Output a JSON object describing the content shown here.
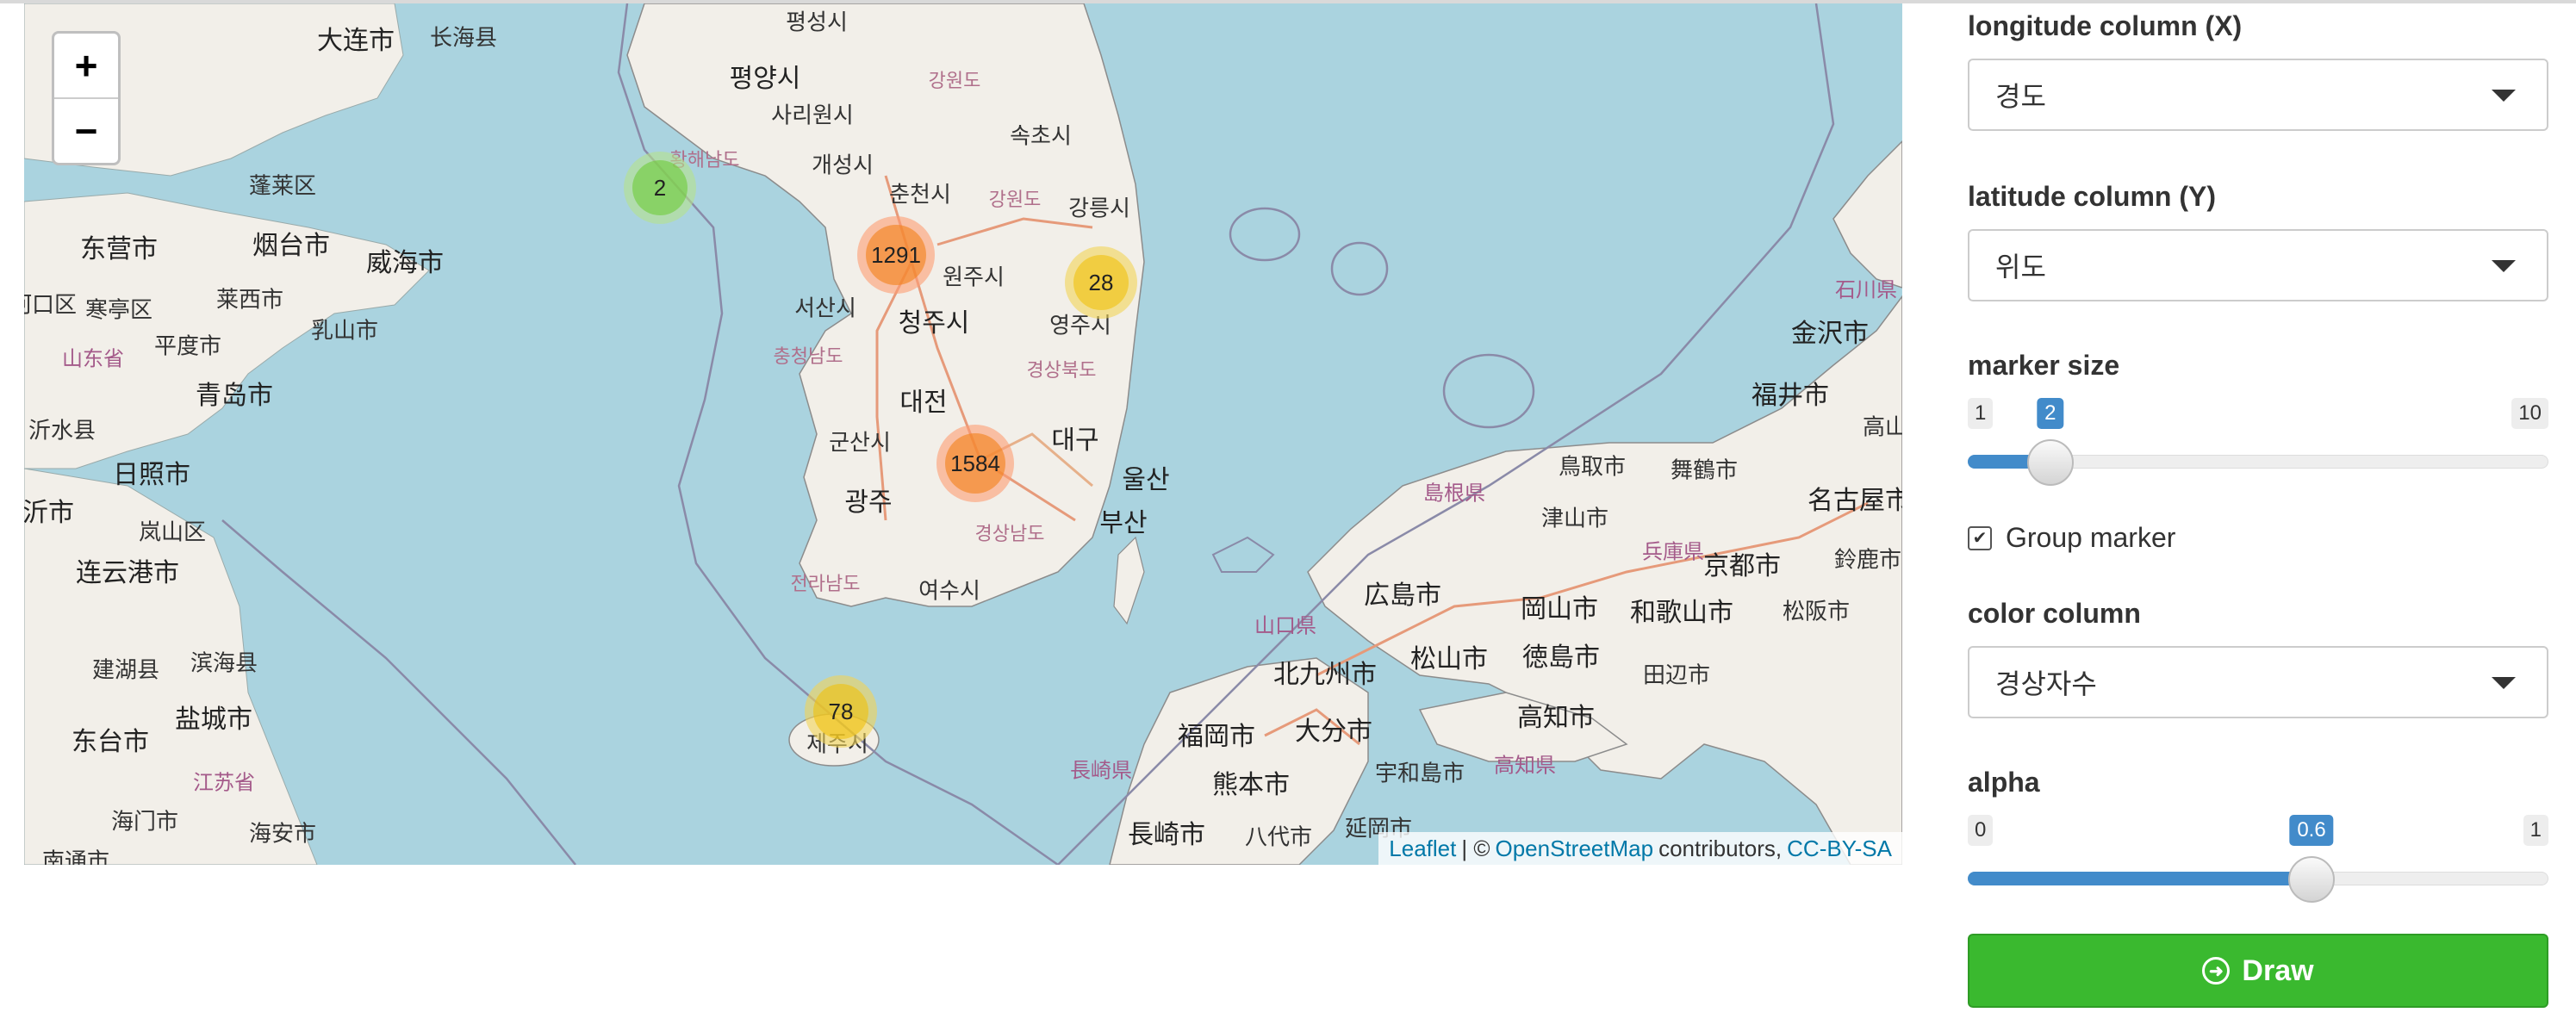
{
  "map": {
    "zoom_in": "+",
    "zoom_out": "−",
    "places": {
      "dalian": "大连市",
      "changhai": "长海县",
      "pyongsong": "평성시",
      "pyongyang": "평양시",
      "gangwon_n": "강원도",
      "sariwon": "사리원시",
      "hwanghae_s": "황해남도",
      "gaeseong": "개성시",
      "sokcho": "속초시",
      "chuncheon": "춘천시",
      "gangwon_s": "강원도",
      "gangneung": "강릉시",
      "wonju": "원주시",
      "seosan": "서산시",
      "cheongju": "청주시",
      "yeongju": "영주시",
      "chungnam": "충청남도",
      "gyeongbuk": "경상북도",
      "daejeon": "대전",
      "gunsan": "군산시",
      "daegu": "대구",
      "gwangju": "광주",
      "ulsan": "울산",
      "busan": "부산",
      "gyeongnam": "경상남도",
      "jeonnam": "전라남도",
      "yeosu": "여수시",
      "jeju": "제주시",
      "penglai": "蓬莱区",
      "dongying": "东营市",
      "yantai": "烟台市",
      "weihai": "威海市",
      "laixi": "莱西市",
      "pingdu": "平度市",
      "rushan": "乳山市",
      "shandong": "山东省",
      "hekou": "河口区",
      "hanting": "寒亭区",
      "qingdao": "青岛市",
      "yishui": "沂水县",
      "rizhao": "日照市",
      "linyi": "沂市",
      "lanshan": "岚山区",
      "lianyungang": "连云港市",
      "jianhu": "建湖县",
      "binhai": "滨海县",
      "yancheng": "盐城市",
      "dongtai": "东台市",
      "jiangsu": "江苏省",
      "haimen": "海门市",
      "haian": "海安市",
      "nantong": "南通市",
      "kanazawa": "金沢市",
      "ishikawa": "石川県",
      "fukui": "福井市",
      "tottori": "鳥取市",
      "maizuru": "舞鶴市",
      "shimane": "島根県",
      "tsuyama": "津山市",
      "hyogo": "兵庫県",
      "nagoya": "名古屋市",
      "kyoto": "京都市",
      "suzuka": "鈴鹿市",
      "hiroshima": "広島市",
      "okayama": "岡山市",
      "wakayama": "和歌山市",
      "matsusaka": "松阪市",
      "yamaguchi": "山口県",
      "kitakyushu": "北九州市",
      "matsuyama": "松山市",
      "tokushima": "徳島市",
      "tanabe": "田辺市",
      "fukuoka": "福岡市",
      "oita": "大分市",
      "kochi": "高知市",
      "nagasaki_p": "長崎県",
      "kumamoto": "熊本市",
      "uwajima": "宇和島市",
      "kochi_p": "高知県",
      "nagasaki": "長崎市",
      "yatsushiro": "八代市",
      "miyazaki": "延岡市",
      "takayama": "高山"
    },
    "clusters": [
      {
        "count": "2",
        "size": "small"
      },
      {
        "count": "1291",
        "size": "large"
      },
      {
        "count": "28",
        "size": "medium"
      },
      {
        "count": "1584",
        "size": "large"
      },
      {
        "count": "78",
        "size": "medium"
      }
    ],
    "attribution": {
      "leaflet": "Leaflet",
      "sep": "| ©",
      "osm": "OpenStreetMap",
      "contributors": "contributors,",
      "license": "CC-BY-SA"
    }
  },
  "controls": {
    "longitude": {
      "label": "longitude column (X)",
      "value": "경도"
    },
    "latitude": {
      "label": "latitude column (Y)",
      "value": "위도"
    },
    "marker_size": {
      "label": "marker size",
      "min": "1",
      "max": "10",
      "value": "2",
      "fraction": 0.111
    },
    "group_marker": {
      "label": "Group marker",
      "checked": true,
      "check_glyph": "✔"
    },
    "color_column": {
      "label": "color column",
      "value": "경상자수"
    },
    "alpha": {
      "label": "alpha",
      "min": "0",
      "max": "1",
      "value": "0.6",
      "fraction": 0.6
    },
    "draw_button": {
      "label": "Draw",
      "icon": "arrow-circle-right-icon",
      "icon_glyph": "➜"
    }
  },
  "colors": {
    "water": "#aad3df",
    "land": "#f2efe9",
    "button": "#3ab92f",
    "slider": "#428bca"
  }
}
